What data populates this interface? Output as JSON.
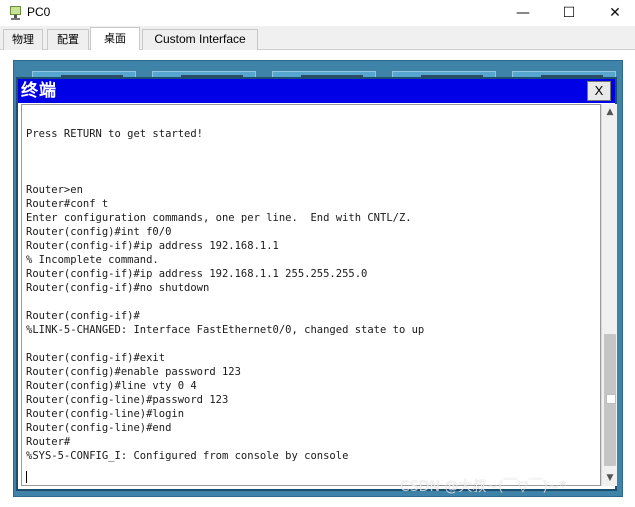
{
  "window": {
    "title": "PC0",
    "minimize_glyph": "—",
    "maximize_glyph": "☐",
    "close_glyph": "✕"
  },
  "tabs": [
    {
      "label": "物理"
    },
    {
      "label": "配置"
    },
    {
      "label": "桌面"
    },
    {
      "label": "Custom Interface"
    }
  ],
  "active_tab": "桌面",
  "terminal": {
    "title": "终端",
    "close_label": "X",
    "lines": [
      "",
      "Press RETURN to get started!",
      "",
      "",
      "",
      "Router>en",
      "Router#conf t",
      "Enter configuration commands, one per line.  End with CNTL/Z.",
      "Router(config)#int f0/0",
      "Router(config-if)#ip address 192.168.1.1",
      "% Incomplete command.",
      "Router(config-if)#ip address 192.168.1.1 255.255.255.0",
      "Router(config-if)#no shutdown",
      "",
      "Router(config-if)#",
      "%LINK-5-CHANGED: Interface FastEthernet0/0, changed state to up",
      "",
      "Router(config-if)#exit",
      "Router(config)#enable password 123",
      "Router(config)#line vty 0 4",
      "Router(config-line)#password 123",
      "Router(config-line)#login",
      "Router(config-line)#end",
      "Router#",
      "%SYS-5-CONFIG_I: Configured from console by console"
    ]
  },
  "scrollbar": {
    "up_glyph": "▲",
    "down_glyph": "▼"
  },
  "watermark": "CSDN @大叔~(￣▽￣)~*",
  "colors": {
    "terminal_header": "#0000e6",
    "desktop_bg": "#3f83a8"
  }
}
